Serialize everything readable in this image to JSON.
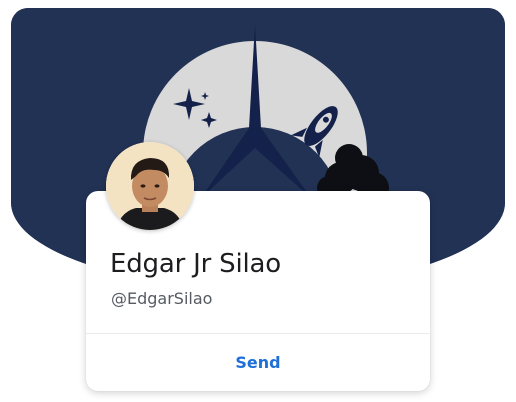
{
  "profile": {
    "name": "Edgar Jr Silao",
    "handle": "@EdgarSilao",
    "send_label": "Send"
  },
  "banner": {
    "description_icons": [
      "moon-icon",
      "sparkle-icon",
      "rocket-icon",
      "smoke-cloud-icon"
    ]
  },
  "colors": {
    "banner_bg": "#223254",
    "moon": "#d9d9d9",
    "dark_navy": "#14214a",
    "accent": "#1e6fd9"
  }
}
